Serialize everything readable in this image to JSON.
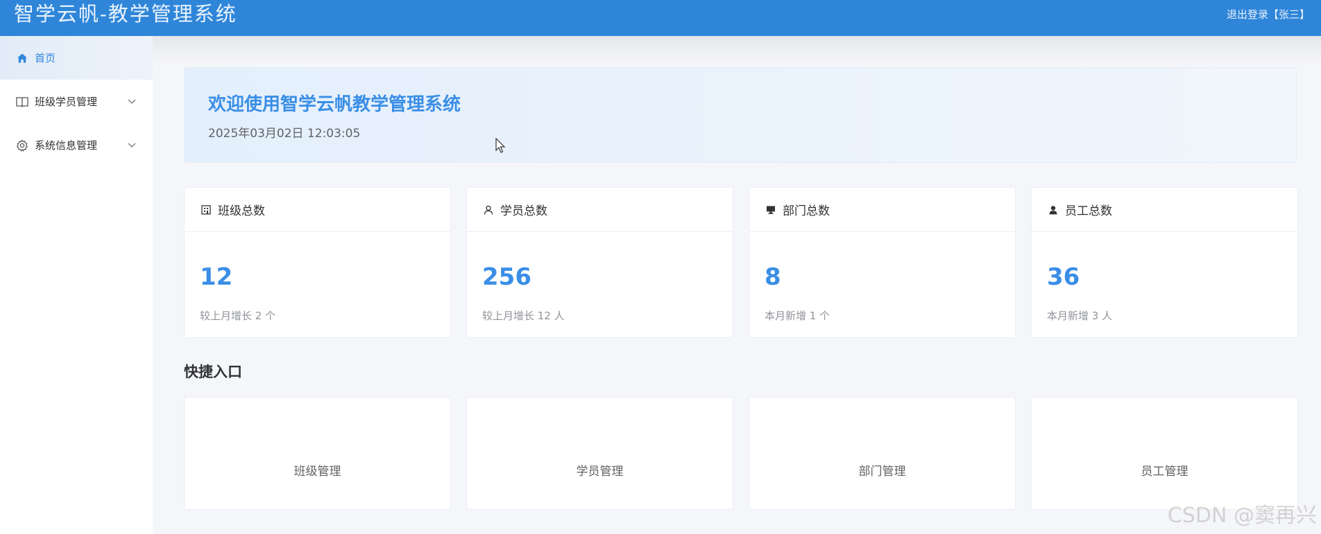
{
  "header": {
    "app_title": "智学云帆-教学管理系统",
    "logout_label": "退出登录【张三】",
    "bg_color": "#2f86d9"
  },
  "sidebar": {
    "items": [
      {
        "label": "首页",
        "icon": "home-icon",
        "active": true
      },
      {
        "label": "班级学员管理",
        "icon": "book-icon",
        "expandable": true
      },
      {
        "label": "系统信息管理",
        "icon": "gear-icon",
        "expandable": true
      }
    ]
  },
  "welcome": {
    "title": "欢迎使用智学云帆教学管理系统",
    "datetime": "2025年03月02日 12:03:05"
  },
  "stats": [
    {
      "title": "班级总数",
      "icon": "building-icon",
      "value": "12",
      "note": "较上月增长 2 个"
    },
    {
      "title": "学员总数",
      "icon": "user-outline-icon",
      "value": "256",
      "note": "较上月增长 12 人"
    },
    {
      "title": "部门总数",
      "icon": "monitor-icon",
      "value": "8",
      "note": "本月新增 1 个"
    },
    {
      "title": "员工总数",
      "icon": "user-filled-icon",
      "value": "36",
      "note": "本月新增 3 人"
    }
  ],
  "quick_access": {
    "title": "快捷入口",
    "items": [
      {
        "label": "班级管理"
      },
      {
        "label": "学员管理"
      },
      {
        "label": "部门管理"
      },
      {
        "label": "员工管理"
      }
    ]
  },
  "watermark": "CSDN @窦再兴",
  "colors": {
    "accent": "#3a8ee6",
    "primary_header": "#2f86d9"
  }
}
